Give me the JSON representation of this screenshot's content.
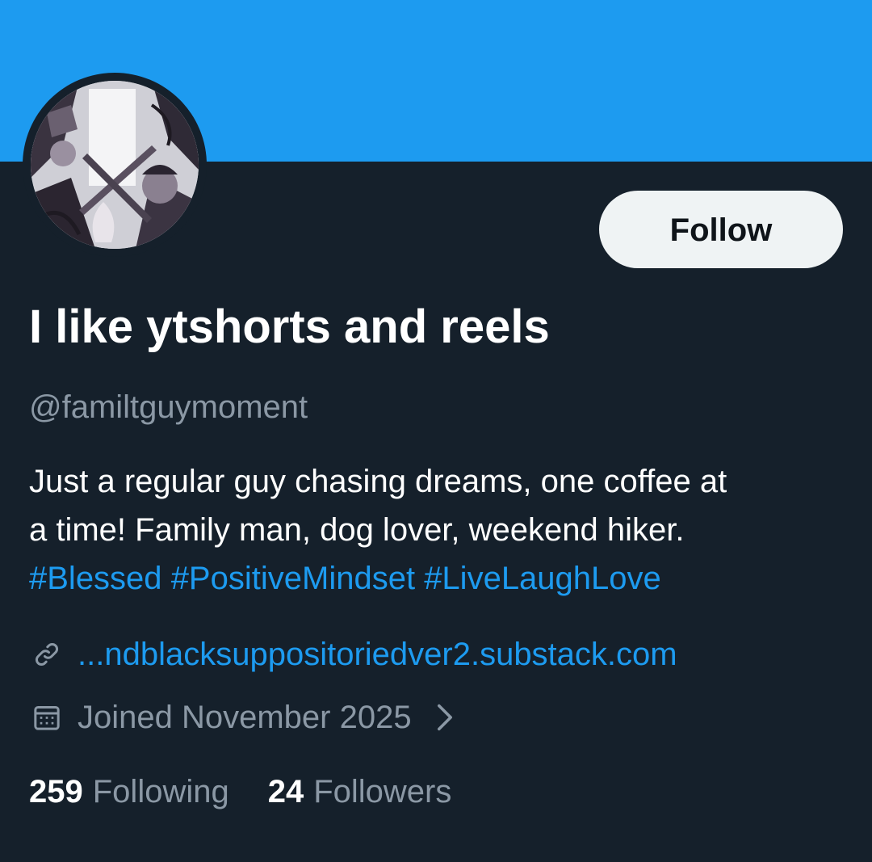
{
  "profile": {
    "display_name": "I like ytshorts and reels",
    "handle": "@familtguymoment",
    "follow_label": "Follow",
    "bio_lines": [
      "Just a regular guy chasing dreams, one coffee at",
      "a time!  Family man, dog lover, weekend hiker."
    ],
    "hashtags": [
      "#Blessed",
      "#PositiveMindset",
      "#LiveLaughLove"
    ],
    "website": "...ndblacksuppositoriedver2.substack.com",
    "joined": "Joined November 2025",
    "following_count": "259",
    "following_label": "Following",
    "followers_count": "24",
    "followers_label": "Followers"
  },
  "icons": {
    "link": "link-icon",
    "calendar": "calendar-icon",
    "chevron": "chevron-right-icon"
  },
  "colors": {
    "banner": "#1d9bf0",
    "background": "#15202b",
    "accent": "#1d9bf0",
    "secondary_text": "#8b98a5",
    "follow_button_bg": "#eff3f4",
    "follow_button_text": "#0f1419"
  }
}
